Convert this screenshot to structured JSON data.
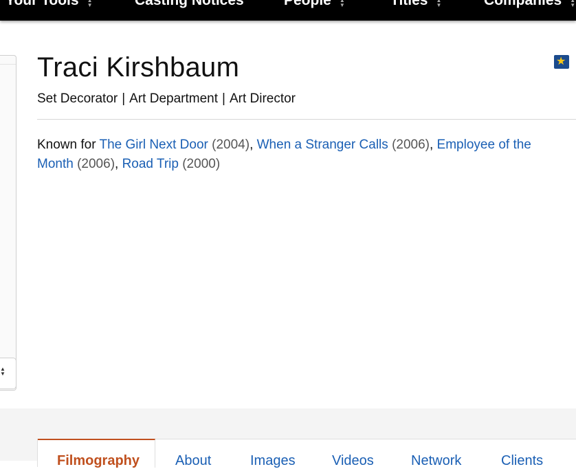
{
  "nav": {
    "items": [
      {
        "label": "Your Tools"
      },
      {
        "label": "Casting Notices"
      },
      {
        "label": "People"
      },
      {
        "label": "Titles"
      },
      {
        "label": "Companies"
      }
    ]
  },
  "person": {
    "name": "Traci Kirshbaum",
    "roles": [
      "Set Decorator",
      "Art Department",
      "Art Director"
    ],
    "role_separator": "|"
  },
  "known_for": {
    "prefix": "Known for",
    "titles": [
      {
        "title": "The Girl Next Door",
        "year": "(2004)"
      },
      {
        "title": "When a Stranger Calls",
        "year": "(2006)"
      },
      {
        "title": "Employee of the Month",
        "year": "(2006)"
      },
      {
        "title": "Road Trip",
        "year": "(2000)"
      }
    ]
  },
  "tabs": [
    {
      "label": "Filmography",
      "active": true
    },
    {
      "label": "About"
    },
    {
      "label": "Images"
    },
    {
      "label": "Videos"
    },
    {
      "label": "Network"
    },
    {
      "label": "Clients"
    }
  ],
  "colors": {
    "nav_bg": "#000000",
    "link": "#1a5fb4",
    "active_tab": "#c0501e",
    "badge_bg": "#1b4b8d",
    "star": "#f5c518"
  },
  "icons": {
    "star_badge": "star-icon",
    "nav_caret": "sort-caret-icon"
  }
}
